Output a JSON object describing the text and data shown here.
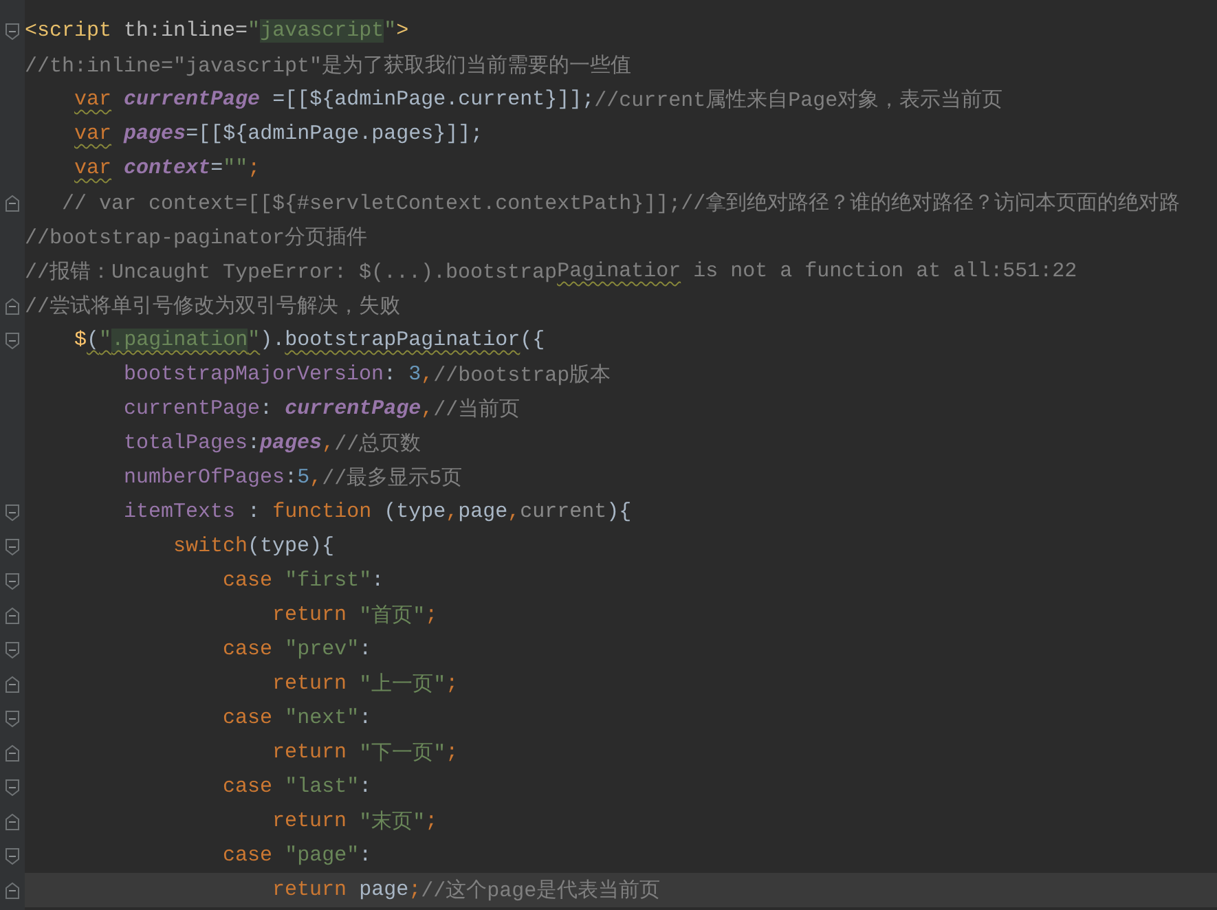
{
  "editor": {
    "lines": [
      {
        "kind": "fold-start",
        "tokens": [
          {
            "text": "<script",
            "kind": "tag"
          },
          {
            "text": " th:inline=",
            "kind": "attr"
          },
          {
            "text": "\"",
            "kind": "str"
          },
          {
            "text": "javascript",
            "kind": "str",
            "highlight": true
          },
          {
            "text": "\"",
            "kind": "str"
          },
          {
            "text": ">",
            "kind": "tag"
          }
        ]
      },
      {
        "kind": "plain",
        "tokens": [
          {
            "text": "//th:inline=\"javascript\"是为了获取我们当前需要的一些值",
            "kind": "comment"
          }
        ]
      },
      {
        "kind": "plain",
        "tokens": [
          {
            "text": "    var",
            "kind": "kw",
            "warn": true
          },
          {
            "text": " currentPage",
            "kind": "var"
          },
          {
            "text": " =[[${adminPage.current}]];",
            "kind": "plain"
          },
          {
            "text": "//current属性来自Page对象，表示当前页",
            "kind": "comment"
          }
        ]
      },
      {
        "kind": "plain",
        "tokens": [
          {
            "text": "    var",
            "kind": "kw",
            "warn": true
          },
          {
            "text": " pages",
            "kind": "var"
          },
          {
            "text": "=[[${adminPage.pages}]];",
            "kind": "plain"
          }
        ]
      },
      {
        "kind": "plain",
        "tokens": [
          {
            "text": "    var",
            "kind": "kw",
            "warn": true
          },
          {
            "text": " context",
            "kind": "var"
          },
          {
            "text": "=",
            "kind": "plain"
          },
          {
            "text": "\"\"",
            "kind": "str"
          },
          {
            "text": ";",
            "kind": "kw"
          }
        ]
      },
      {
        "kind": "fold-end",
        "tokens": [
          {
            "text": "   // var context=[[${#servletContext.contextPath}]];//拿到绝对路径？谁的绝对路径？访问本页面的绝对路",
            "kind": "comment"
          }
        ]
      },
      {
        "kind": "plain",
        "tokens": [
          {
            "text": "//bootstrap-paginator分页插件",
            "kind": "comment"
          }
        ]
      },
      {
        "kind": "plain",
        "tokens": [
          {
            "text": "//报错：Uncaught TypeError: $(...).bootstrap",
            "kind": "comment"
          },
          {
            "text": "Paginatior",
            "kind": "comment",
            "warn": true
          },
          {
            "text": " is not a function at all:551:22",
            "kind": "comment"
          }
        ]
      },
      {
        "kind": "fold-end",
        "tokens": [
          {
            "text": "//尝试将单引号修改为双引号解决，失败",
            "kind": "comment"
          }
        ]
      },
      {
        "kind": "fold-start",
        "tokens": [
          {
            "text": "    $",
            "kind": "fn"
          },
          {
            "text": "(",
            "kind": "plain",
            "warn": true
          },
          {
            "text": "\"",
            "kind": "str",
            "warn": true
          },
          {
            "text": ".pagination",
            "kind": "str",
            "warn": true,
            "highlight": true
          },
          {
            "text": "\"",
            "kind": "str",
            "warn": true
          },
          {
            "text": ").",
            "kind": "plain"
          },
          {
            "text": "bootstrapPaginatior",
            "kind": "plain",
            "warn": true
          },
          {
            "text": "({",
            "kind": "plain"
          }
        ]
      },
      {
        "kind": "plain",
        "tokens": [
          {
            "text": "        bootstrapMajorVersion",
            "kind": "prop"
          },
          {
            "text": ": ",
            "kind": "plain"
          },
          {
            "text": "3",
            "kind": "num"
          },
          {
            "text": ",",
            "kind": "kw"
          },
          {
            "text": "//bootstrap版本",
            "kind": "comment"
          }
        ]
      },
      {
        "kind": "plain",
        "tokens": [
          {
            "text": "        currentPage",
            "kind": "prop"
          },
          {
            "text": ": ",
            "kind": "plain"
          },
          {
            "text": "currentPage",
            "kind": "var"
          },
          {
            "text": ",",
            "kind": "kw"
          },
          {
            "text": "//当前页",
            "kind": "comment"
          }
        ]
      },
      {
        "kind": "plain",
        "tokens": [
          {
            "text": "        totalPages",
            "kind": "prop"
          },
          {
            "text": ":",
            "kind": "plain"
          },
          {
            "text": "pages",
            "kind": "var"
          },
          {
            "text": ",",
            "kind": "kw"
          },
          {
            "text": "//总页数",
            "kind": "comment"
          }
        ]
      },
      {
        "kind": "plain",
        "tokens": [
          {
            "text": "        numberOfPages",
            "kind": "prop"
          },
          {
            "text": ":",
            "kind": "plain"
          },
          {
            "text": "5",
            "kind": "num"
          },
          {
            "text": ",",
            "kind": "kw"
          },
          {
            "text": "//最多显示5页",
            "kind": "comment"
          }
        ]
      },
      {
        "kind": "fold-start",
        "tokens": [
          {
            "text": "        itemTexts",
            "kind": "prop"
          },
          {
            "text": " : ",
            "kind": "plain"
          },
          {
            "text": "function",
            "kind": "kw"
          },
          {
            "text": " (type",
            "kind": "plain"
          },
          {
            "text": ",",
            "kind": "kw"
          },
          {
            "text": "page",
            "kind": "plain"
          },
          {
            "text": ",",
            "kind": "kw"
          },
          {
            "text": "current",
            "kind": "param"
          },
          {
            "text": "){",
            "kind": "plain"
          }
        ]
      },
      {
        "kind": "fold-start",
        "tokens": [
          {
            "text": "            switch",
            "kind": "kw"
          },
          {
            "text": "(type){",
            "kind": "plain"
          }
        ]
      },
      {
        "kind": "fold-start",
        "tokens": [
          {
            "text": "                case",
            "kind": "kw"
          },
          {
            "text": " \"first\"",
            "kind": "str"
          },
          {
            "text": ":",
            "kind": "plain"
          }
        ]
      },
      {
        "kind": "fold-end",
        "tokens": [
          {
            "text": "                    return",
            "kind": "kw"
          },
          {
            "text": " \"首页\"",
            "kind": "str"
          },
          {
            "text": ";",
            "kind": "kw"
          }
        ]
      },
      {
        "kind": "fold-start",
        "tokens": [
          {
            "text": "                case",
            "kind": "kw"
          },
          {
            "text": " \"prev\"",
            "kind": "str"
          },
          {
            "text": ":",
            "kind": "plain"
          }
        ]
      },
      {
        "kind": "fold-end",
        "tokens": [
          {
            "text": "                    return",
            "kind": "kw"
          },
          {
            "text": " \"上一页\"",
            "kind": "str"
          },
          {
            "text": ";",
            "kind": "kw"
          }
        ]
      },
      {
        "kind": "fold-start",
        "tokens": [
          {
            "text": "                case",
            "kind": "kw"
          },
          {
            "text": " \"next\"",
            "kind": "str"
          },
          {
            "text": ":",
            "kind": "plain"
          }
        ]
      },
      {
        "kind": "fold-end",
        "tokens": [
          {
            "text": "                    return",
            "kind": "kw"
          },
          {
            "text": " \"下一页\"",
            "kind": "str"
          },
          {
            "text": ";",
            "kind": "kw"
          }
        ]
      },
      {
        "kind": "fold-start",
        "tokens": [
          {
            "text": "                case",
            "kind": "kw"
          },
          {
            "text": " \"last\"",
            "kind": "str"
          },
          {
            "text": ":",
            "kind": "plain"
          }
        ]
      },
      {
        "kind": "fold-end",
        "tokens": [
          {
            "text": "                    return",
            "kind": "kw"
          },
          {
            "text": " \"末页\"",
            "kind": "str"
          },
          {
            "text": ";",
            "kind": "kw"
          }
        ]
      },
      {
        "kind": "fold-start",
        "tokens": [
          {
            "text": "                case",
            "kind": "kw"
          },
          {
            "text": " \"page\"",
            "kind": "str"
          },
          {
            "text": ":",
            "kind": "plain"
          }
        ]
      },
      {
        "kind": "fold-end",
        "current": true,
        "tokens": [
          {
            "text": "                    return",
            "kind": "kw"
          },
          {
            "text": " page",
            "kind": "plain"
          },
          {
            "text": ";",
            "kind": "kw"
          },
          {
            "text": "//这个page是代表当前页",
            "kind": "comment"
          }
        ]
      }
    ]
  }
}
